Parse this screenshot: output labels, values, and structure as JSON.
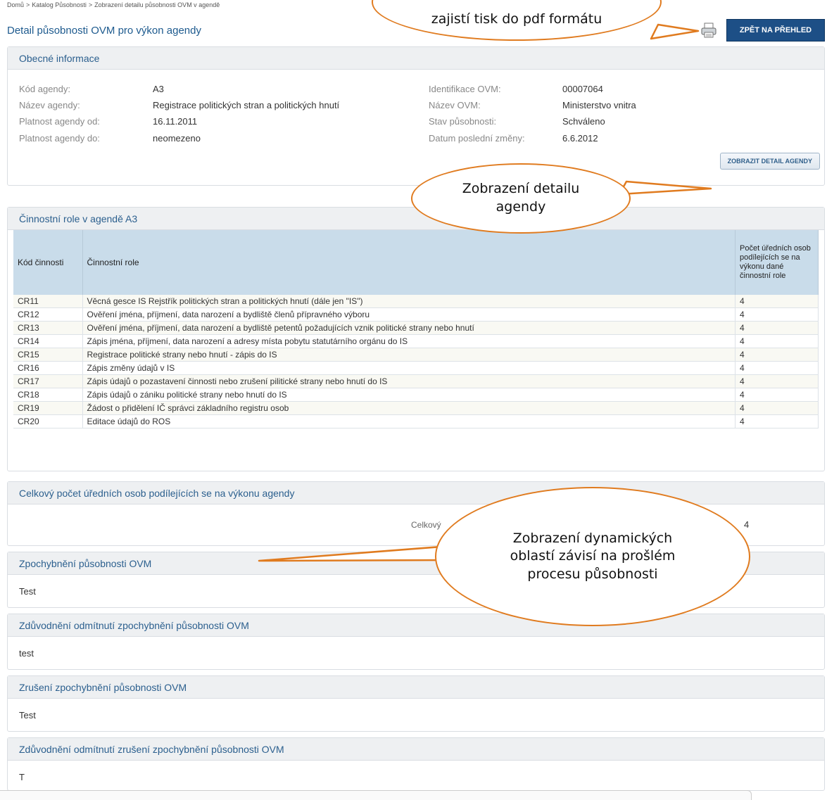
{
  "breadcrumb": [
    "Domů",
    "Katalog Působnosti",
    "Zobrazení detailu působnosti OVM v agendě"
  ],
  "breadcrumb_sep": ">",
  "page_title": "Detail působnosti OVM pro výkon agendy",
  "back_button": "ZPĚT NA PŘEHLED",
  "general": {
    "title": "Obecné informace",
    "left": [
      {
        "label": "Kód agendy:",
        "value": "A3"
      },
      {
        "label": "Název agendy:",
        "value": "Registrace politických stran a politických hnutí"
      },
      {
        "label": "Platnost agendy od:",
        "value": "16.11.2011"
      },
      {
        "label": "Platnost agendy do:",
        "value": "neomezeno"
      }
    ],
    "right": [
      {
        "label": "Identifikace OVM:",
        "value": "00007064"
      },
      {
        "label": "Název OVM:",
        "value": "Ministerstvo vnitra"
      },
      {
        "label": "Stav působnosti:",
        "value": "Schváleno"
      },
      {
        "label": "Datum poslední změny:",
        "value": "6.6.2012"
      }
    ],
    "detail_button": "ZOBRAZIT DETAIL AGENDY"
  },
  "roles": {
    "title": "Činnostní role v agendě A3",
    "headers": [
      "Kód činnosti",
      "Činnostní role",
      "Počet úředních osob podílejících se na výkonu dané činnostní role"
    ],
    "rows": [
      [
        "CR11",
        "Věcná gesce IS Rejstřík politických stran a politických hnutí (dále jen \"IS\")",
        "4"
      ],
      [
        "CR12",
        "Ověření jména, příjmení, data narození a bydliště členů přípravného výboru",
        "4"
      ],
      [
        "CR13",
        "Ověření jména, příjmení, data narození a bydliště petentů požadujících vznik politické strany nebo hnutí",
        "4"
      ],
      [
        "CR14",
        "Zápis jména, příjmení, data narození a adresy místa pobytu statutárního orgánu do IS",
        "4"
      ],
      [
        "CR15",
        "Registrace politické strany nebo hnutí - zápis do IS",
        "4"
      ],
      [
        "CR16",
        "Zápis změny údajů v IS",
        "4"
      ],
      [
        "CR17",
        "Zápis údajů o pozastavení činnosti nebo zrušení pilitické strany nebo hnutí do IS",
        "4"
      ],
      [
        "CR18",
        "Zápis údajů o zániku politické strany nebo hnutí do IS",
        "4"
      ],
      [
        "CR19",
        "Žádost o přidělení IČ správci základního registru osob",
        "4"
      ],
      [
        "CR20",
        "Editace údajů do ROS",
        "4"
      ]
    ]
  },
  "total": {
    "title": "Celkový počet úředních osob podílejících se na výkonu agendy",
    "label": "Celkový",
    "value": "4"
  },
  "sections": [
    {
      "title": "Zpochybnění působnosti OVM",
      "text": "Test"
    },
    {
      "title": "Zdůvodnění odmítnutí zpochybnění působnosti OVM",
      "text": "test"
    },
    {
      "title": "Zrušení zpochybnění působnosti OVM",
      "text": "Test"
    },
    {
      "title": "Zdůvodnění odmítnutí zrušení zpochybnění působnosti OVM",
      "text": "T"
    }
  ],
  "callouts": {
    "print": "zajistí tisk do pdf formátu",
    "detail": "Zobrazení detailu agendy",
    "dynamic": "Zobrazení dynamických oblastí závisí na prošlém procesu působnosti"
  },
  "colors": {
    "accent": "#1d4f86",
    "callout_border": "#e07b1f",
    "table_header": "#c9dcea"
  },
  "icons": [
    "printer-icon"
  ]
}
